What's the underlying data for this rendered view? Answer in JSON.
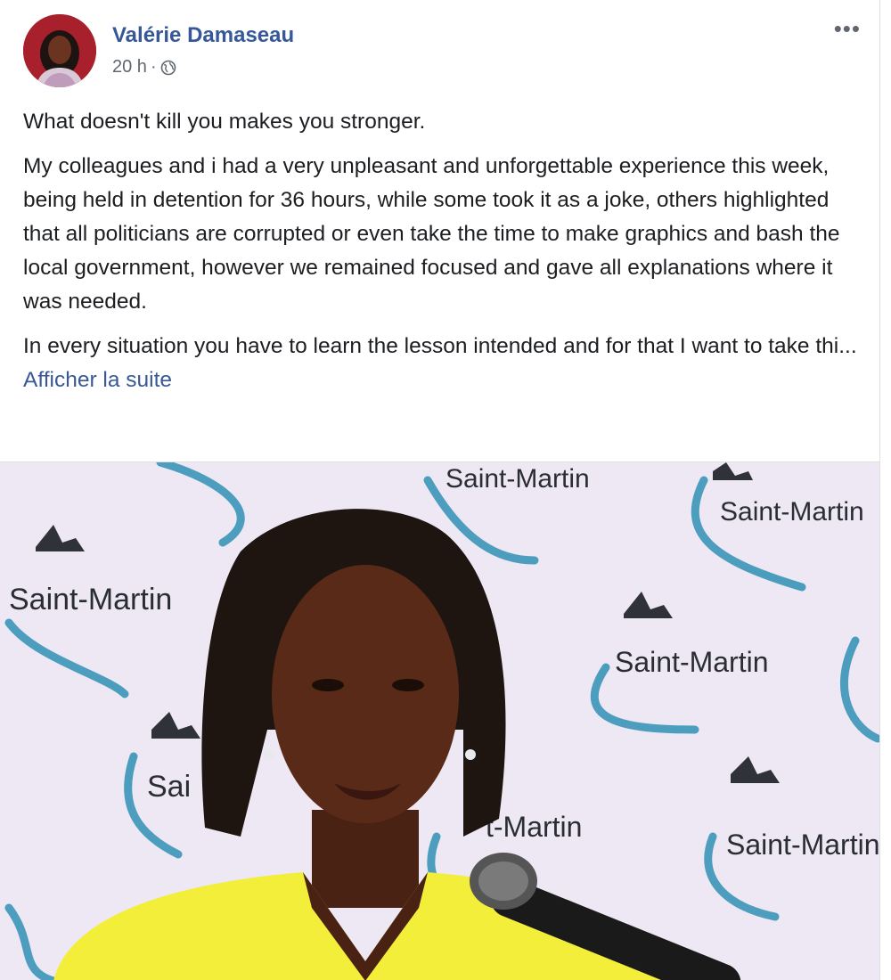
{
  "post": {
    "author": "Valérie Damaseau",
    "time": "20 h",
    "separator": "·",
    "privacy_icon": "globe-icon",
    "menu_icon": "more-options-icon",
    "paragraphs": [
      "What doesn't kill you makes you stronger.",
      "My colleagues and i had a very unpleasant and unforgettable experience this week, being held in detention for 36 hours, while some took it as a joke, others highlighted that all politicians are corrupted or even take the time to make graphics and bash the local government, however we remained focused and gave all explanations where it was needed."
    ],
    "truncated_text": "In every situation you have to learn the lesson intended and for that I want to take thi... ",
    "see_more_label": "Afficher la suite"
  },
  "photo": {
    "backdrop_logo_text": "Saint-Martin",
    "colors": {
      "backdrop": "#ede8f3",
      "wave": "#3a95b8",
      "jacket": "#f2ee3a",
      "hair": "#1e1410",
      "skin": "#5a2a18"
    }
  },
  "theme": {
    "link": "#365899",
    "secondary_text": "#606770"
  }
}
